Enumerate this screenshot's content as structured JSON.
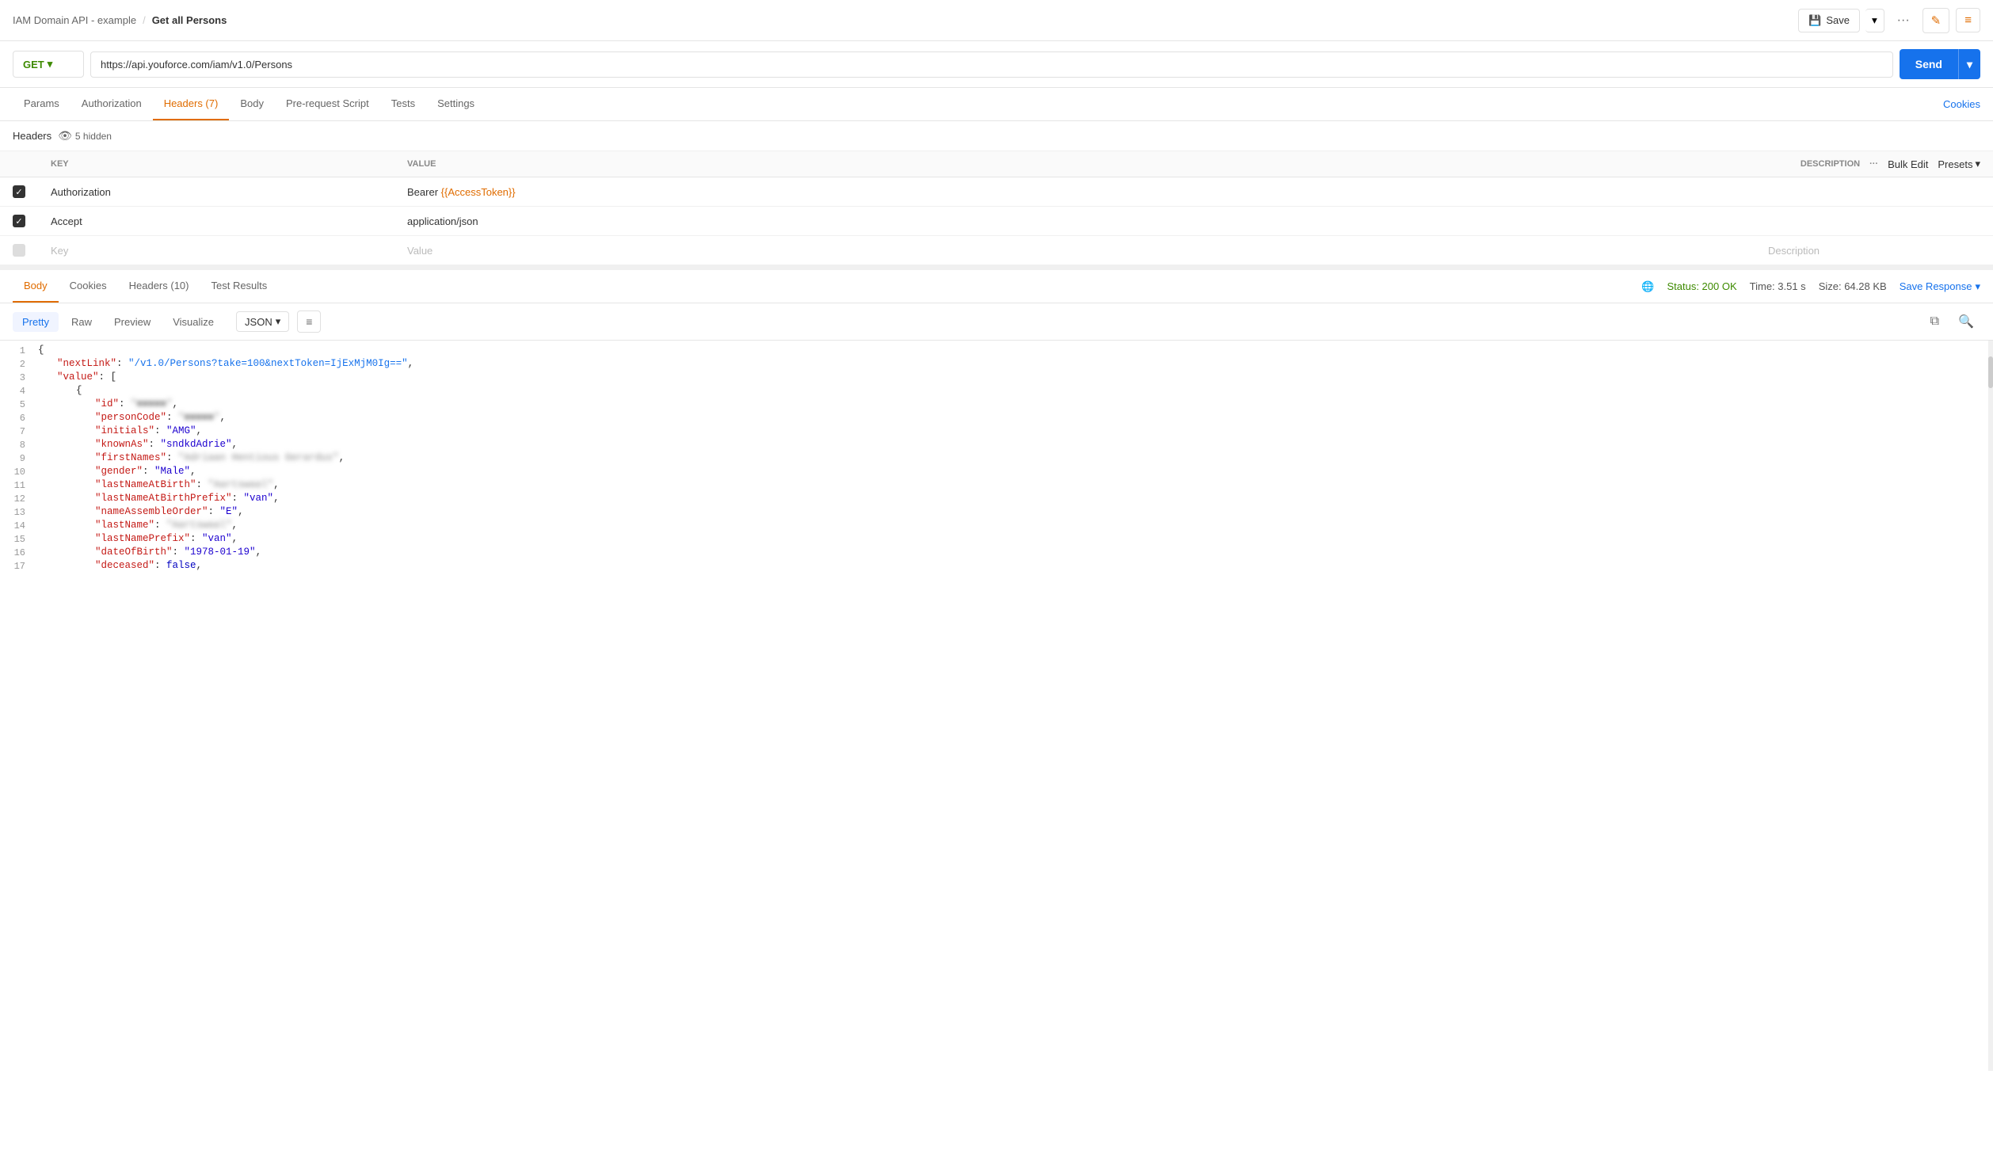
{
  "topbar": {
    "breadcrumb": "IAM Domain API - example",
    "separator": "/",
    "page_title": "Get all Persons",
    "save_label": "Save",
    "more_icon": "···",
    "edit_icon": "✎",
    "doc_icon": "≡"
  },
  "urlbar": {
    "method": "GET",
    "url": "https://api.youforce.com/iam/v1.0/Persons",
    "send_label": "Send"
  },
  "request_tabs": {
    "tabs": [
      {
        "label": "Params",
        "active": false
      },
      {
        "label": "Authorization",
        "active": false
      },
      {
        "label": "Headers (7)",
        "active": true
      },
      {
        "label": "Body",
        "active": false
      },
      {
        "label": "Pre-request Script",
        "active": false
      },
      {
        "label": "Tests",
        "active": false
      },
      {
        "label": "Settings",
        "active": false
      }
    ],
    "cookies_link": "Cookies"
  },
  "headers_section": {
    "label": "Headers",
    "hidden_count": "5 hidden",
    "columns": {
      "key": "KEY",
      "value": "VALUE",
      "description": "DESCRIPTION",
      "bulk_edit": "Bulk Edit",
      "presets": "Presets"
    },
    "rows": [
      {
        "checked": true,
        "key": "Authorization",
        "value_plain": "Bearer ",
        "value_token": "{{AccessToken}}",
        "description": ""
      },
      {
        "checked": true,
        "key": "Accept",
        "value_plain": "application/json",
        "value_token": "",
        "description": ""
      },
      {
        "checked": false,
        "key": "Key",
        "value_plain": "Value",
        "value_token": "",
        "description": "Description",
        "placeholder": true
      }
    ]
  },
  "response": {
    "tabs": [
      {
        "label": "Body",
        "active": true
      },
      {
        "label": "Cookies",
        "active": false
      },
      {
        "label": "Headers (10)",
        "active": false
      },
      {
        "label": "Test Results",
        "active": false
      }
    ],
    "status": "Status: 200 OK",
    "time": "Time: 3.51 s",
    "size": "Size: 64.28 KB",
    "save_response": "Save Response",
    "format_tabs": [
      "Pretty",
      "Raw",
      "Preview",
      "Visualize"
    ],
    "active_format": "Pretty",
    "json_type": "JSON",
    "filter_icon": "≡",
    "copy_icon": "⧉",
    "search_icon": "🔍"
  },
  "json_content": {
    "lines": [
      {
        "num": 1,
        "content": "{"
      },
      {
        "num": 2,
        "key": "nextLink",
        "value": "/v1.0/Persons?take=100&nextToken=IjExMjM0Ig==",
        "link": true,
        "suffix": ","
      },
      {
        "num": 3,
        "key": "value",
        "value": "[",
        "open": true
      },
      {
        "num": 4,
        "content": "        {"
      },
      {
        "num": 5,
        "key": "id",
        "blurred": true,
        "value": "■■■■■"
      },
      {
        "num": 6,
        "key": "personCode",
        "blurred": true,
        "value": "■■■■■"
      },
      {
        "num": 7,
        "key": "initials",
        "value": "AMG"
      },
      {
        "num": 8,
        "key": "knownAs",
        "value": "sndkdAdrie"
      },
      {
        "num": 9,
        "key": "firstNames",
        "blurred": true,
        "value": "Adriaan Hentious Gerardus"
      },
      {
        "num": 10,
        "key": "gender",
        "value": "Male"
      },
      {
        "num": 11,
        "key": "lastNameAtBirth",
        "blurred": true,
        "value": "Aartswaal"
      },
      {
        "num": 12,
        "key": "lastNameAtBirthPrefix",
        "value": "van"
      },
      {
        "num": 13,
        "key": "nameAssembleOrder",
        "value": "E"
      },
      {
        "num": 14,
        "key": "lastName",
        "blurred": true,
        "value": "Aartswaal"
      },
      {
        "num": 15,
        "key": "lastNamePrefix",
        "value": "van"
      },
      {
        "num": 16,
        "key": "dateOfBirth",
        "value": "1978-01-19"
      },
      {
        "num": 17,
        "key": "deceased",
        "bool": "false"
      }
    ]
  }
}
